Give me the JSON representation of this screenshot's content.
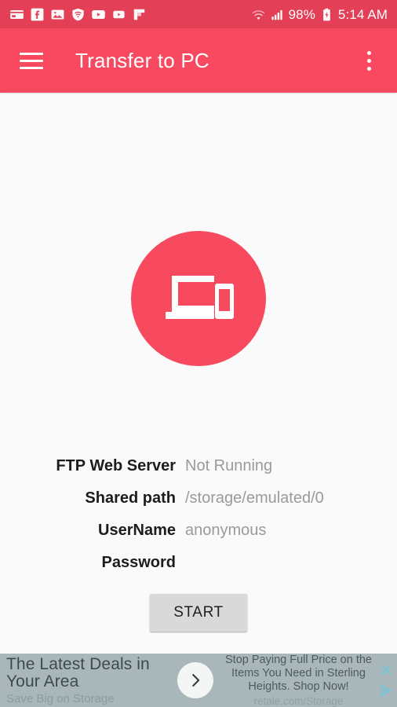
{
  "status_bar": {
    "left_icons": [
      {
        "name": "wallet-icon"
      },
      {
        "name": "facebook-icon"
      },
      {
        "name": "gallery-icon"
      },
      {
        "name": "vpn-shield-icon"
      },
      {
        "name": "youtube-icon"
      },
      {
        "name": "youtube-music-icon"
      },
      {
        "name": "flipboard-icon"
      }
    ],
    "wifi_icon": "wifi-searching-icon",
    "signal_icon": "cellular-signal-icon",
    "battery_percent": "98%",
    "battery_icon": "battery-charging-icon",
    "clock": "5:14 AM",
    "background_color": "#e34057"
  },
  "app_bar": {
    "menu_icon": "hamburger-menu-icon",
    "title": "Transfer to PC",
    "overflow_icon": "overflow-menu-icon",
    "background_color": "#f94961"
  },
  "hero": {
    "icon": "devices-laptop-phone-icon",
    "circle_color": "#f84a5f"
  },
  "form": {
    "rows": [
      {
        "label": "FTP Web Server",
        "value": "Not Running"
      },
      {
        "label": "Shared path",
        "value": "/storage/emulated/0"
      },
      {
        "label": "UserName",
        "value": "anonymous"
      },
      {
        "label": "Password",
        "value": ""
      }
    ]
  },
  "actions": {
    "start_label": "START"
  },
  "ad": {
    "headline": "The Latest Deals in Your Area",
    "subline": "Save Big on Storage",
    "cta_icon": "chevron-right-icon",
    "body": "Stop Paying Full Price on the Items You Need in Sterling Heights. Shop Now!",
    "url": "retale.com/Storage",
    "close_icon": "close-icon",
    "adchoices_icon": "adchoices-icon",
    "background_color": "#a9b7bb"
  }
}
